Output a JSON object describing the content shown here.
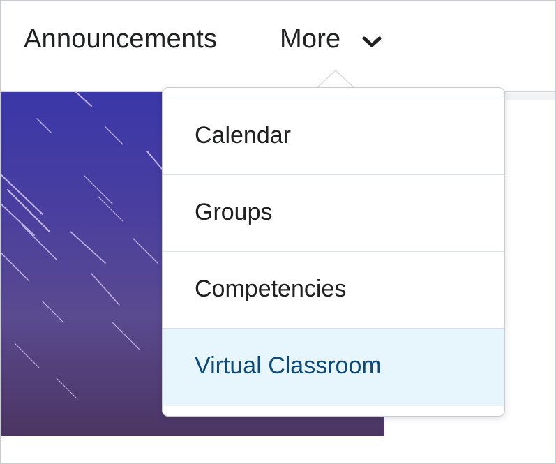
{
  "navbar": {
    "items": [
      {
        "label": "Announcements"
      },
      {
        "label": "More"
      }
    ],
    "more_icon": "chevron-down-icon"
  },
  "dropdown": {
    "items": [
      {
        "label": "Calendar",
        "active": false
      },
      {
        "label": "Groups",
        "active": false
      },
      {
        "label": "Competencies",
        "active": false
      },
      {
        "label": "Virtual Classroom",
        "active": true
      }
    ]
  },
  "colors": {
    "active_bg": "#e7f6fc",
    "active_text": "#0d4a7c",
    "text": "#202122"
  }
}
